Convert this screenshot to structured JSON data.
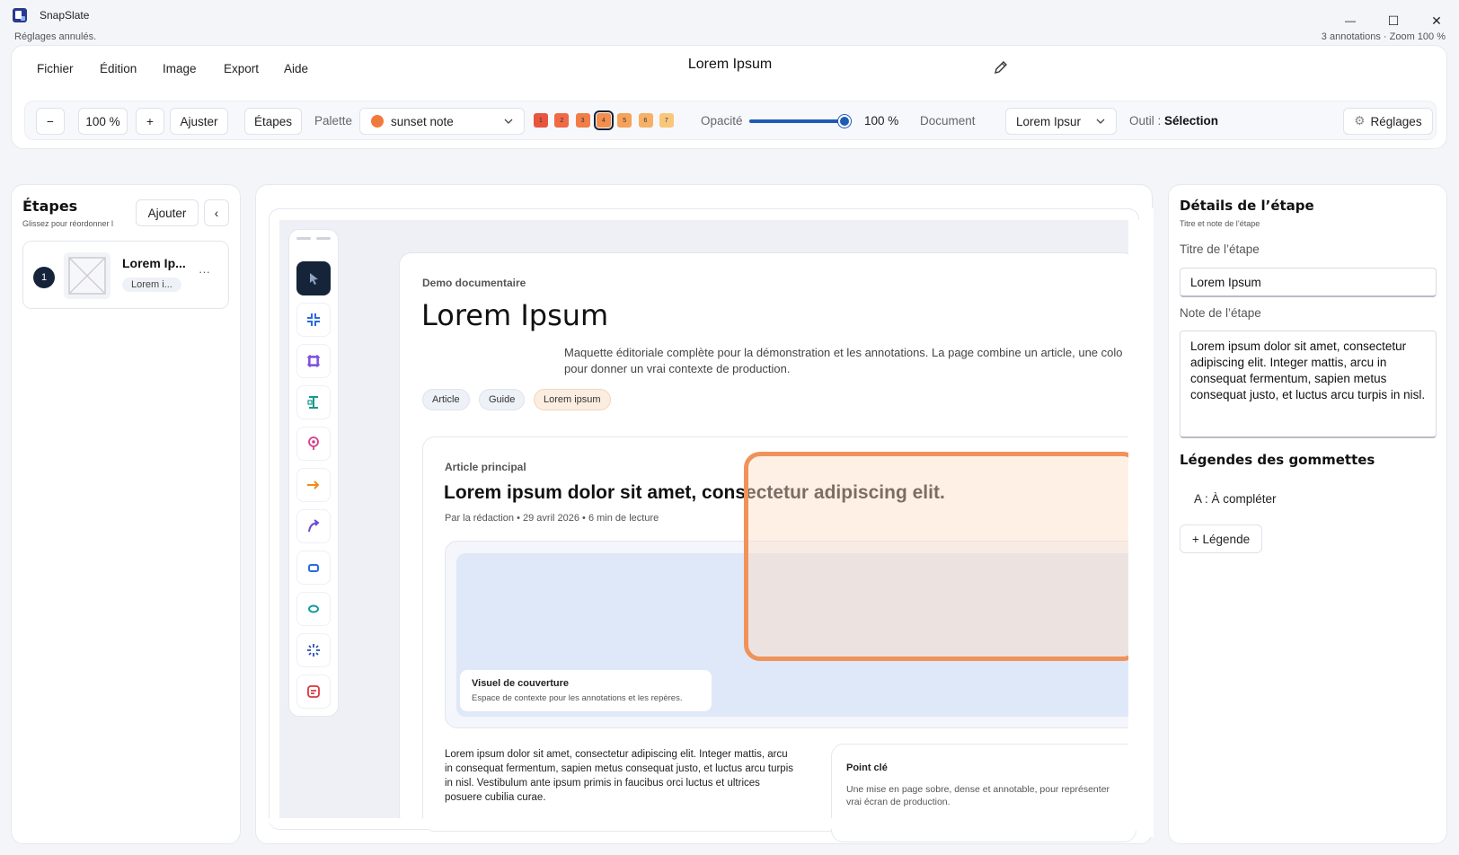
{
  "app": {
    "title": "SnapSlate",
    "status_left": "Réglages annulés.",
    "status_right": "3 annotations · Zoom 100 %"
  },
  "window_controls": {
    "minimize": "—",
    "maximize": "☐",
    "close": "✕"
  },
  "menu": [
    "Fichier",
    "Édition",
    "Image",
    "Export",
    "Aide"
  ],
  "document_title": "Lorem Ipsum",
  "toolbar": {
    "zoom_out": "−",
    "zoom_value": "100 %",
    "zoom_in": "+",
    "fit": "Ajuster",
    "steps": "Étapes",
    "palette_label": "Palette",
    "palette_value": "sunset note",
    "palette_color": "#f07a3c",
    "swatches": [
      {
        "n": "1",
        "color": "#e8553f"
      },
      {
        "n": "2",
        "color": "#ef6a45"
      },
      {
        "n": "3",
        "color": "#f07e47"
      },
      {
        "n": "4",
        "color": "#f38e4c"
      },
      {
        "n": "5",
        "color": "#f6a25a"
      },
      {
        "n": "6",
        "color": "#f6b167"
      },
      {
        "n": "7",
        "color": "#f9c77a"
      }
    ],
    "opacity_label": "Opacité",
    "opacity_value": "100 %",
    "opacity_fraction": 1.0,
    "document_label": "Document",
    "document_value": "Lorem Ipsur",
    "tool_label": "Outil :",
    "tool_value": "Sélection",
    "settings": "Réglages"
  },
  "steps_panel": {
    "title": "Étapes",
    "subtitle": "Glissez pour réordonner l",
    "add": "Ajouter",
    "collapse": "‹",
    "items": [
      {
        "num": "1",
        "title": "Lorem Ip...",
        "tag": "Lorem i...",
        "more": "···"
      }
    ]
  },
  "canvas": {
    "page": {
      "kicker": "Demo documentaire",
      "title": "Lorem Ipsum",
      "lead1": "Maquette éditoriale complète pour la démonstration et les annotations. La page combine un article, une colo",
      "lead2": "pour donner un vrai contexte de production.",
      "tags": [
        "Article",
        "Guide",
        "Lorem ipsum"
      ],
      "article_kicker": "Article principal",
      "article_title": "Lorem ipsum dolor sit amet, consectetur adipiscing elit.",
      "article_meta": "Par la rédaction • 29 avril 2026 • 6 min de lecture",
      "cover_title": "Visuel de couverture",
      "cover_sub": "Espace de contexte pour les annotations et les repères.",
      "body1": "Lorem ipsum dolor sit amet, consectetur adipiscing elit. Integer mattis, arcu",
      "body2": "in consequat fermentum, sapien metus consequat justo, et luctus arcu turpis",
      "body3": "in nisl. Vestibulum ante ipsum primis in faucibus orci luctus et ultrices",
      "body4": "posuere cubilia curae.",
      "key_title": "Point clé",
      "key_text1": "Une mise en page sobre, dense et annotable, pour représenter",
      "key_text2": "vrai écran de production."
    }
  },
  "details_panel": {
    "title": "Détails de l’étape",
    "subtitle": "Titre et note de l’étape",
    "step_title_label": "Titre de l’étape",
    "step_title_value": "Lorem Ipsum",
    "note_label": "Note de l’étape",
    "note_value": "Lorem ipsum dolor sit amet, consectetur adipiscing elit. Integer mattis, arcu in consequat fermentum, sapien metus consequat justo, et luctus arcu turpis in nisl.",
    "legends_title": "Légendes des gommettes",
    "legend_item": "A : À compléter",
    "add_legend": "+ Légende"
  }
}
